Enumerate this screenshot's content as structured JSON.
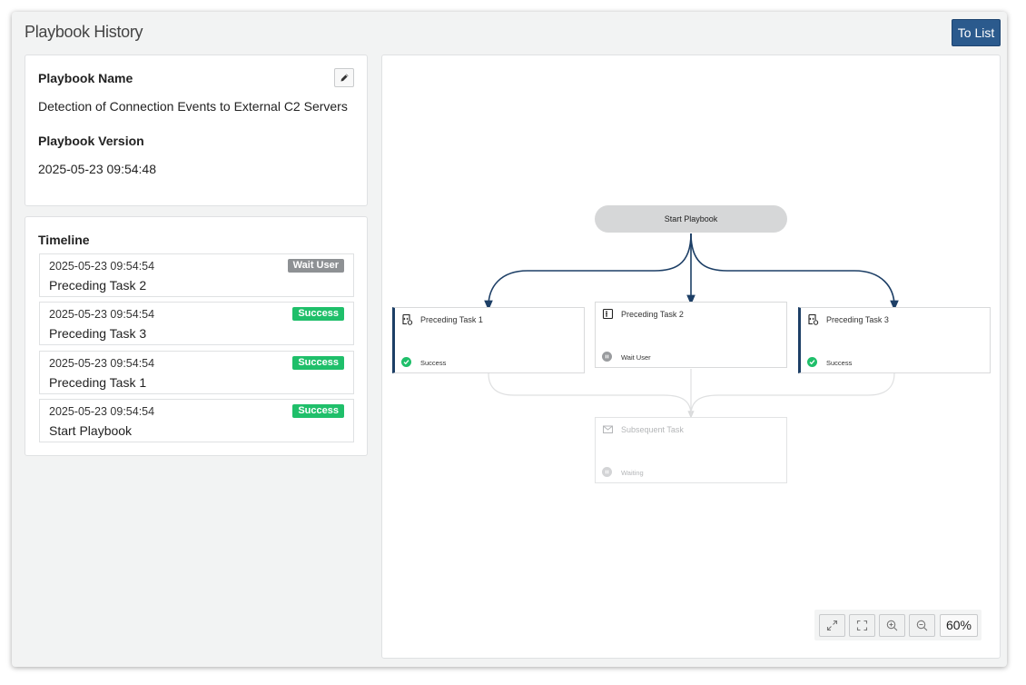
{
  "header": {
    "title": "Playbook History",
    "to_list_label": "To List"
  },
  "info": {
    "name_label": "Playbook Name",
    "name_value": "Detection of Connection Events to External C2 Servers",
    "version_label": "Playbook Version",
    "version_value": "2025-05-23 09:54:48",
    "edit_icon": "pencil-icon"
  },
  "timeline": {
    "title": "Timeline",
    "items": [
      {
        "time": "2025-05-23 09:54:54",
        "name": "Preceding Task 2",
        "status": "Wait User",
        "status_color": "#8e9194"
      },
      {
        "time": "2025-05-23 09:54:54",
        "name": "Preceding Task 3",
        "status": "Success",
        "status_color": "#1fbf6a"
      },
      {
        "time": "2025-05-23 09:54:54",
        "name": "Preceding Task 1",
        "status": "Success",
        "status_color": "#1fbf6a"
      },
      {
        "time": "2025-05-23 09:54:54",
        "name": "Start Playbook",
        "status": "Success",
        "status_color": "#1fbf6a"
      }
    ]
  },
  "flow": {
    "start_label": "Start Playbook",
    "tasks": [
      {
        "name": "Preceding Task 1",
        "status": "Success",
        "icon": "script-icon"
      },
      {
        "name": "Preceding Task 2",
        "status": "Wait User",
        "icon": "form-icon"
      },
      {
        "name": "Preceding Task 3",
        "status": "Success",
        "icon": "script-icon"
      },
      {
        "name": "Subsequent Task",
        "status": "Waiting",
        "icon": "mail-icon"
      }
    ],
    "edge_color": "#1d3f66"
  },
  "zoom": {
    "level": "60%",
    "buttons": [
      "expand-icon",
      "fullscreen-icon",
      "zoom-in-icon",
      "zoom-out-icon"
    ]
  },
  "colors": {
    "accent": "#2b5a8d",
    "success": "#1fbf6a",
    "wait": "#8e9194"
  }
}
